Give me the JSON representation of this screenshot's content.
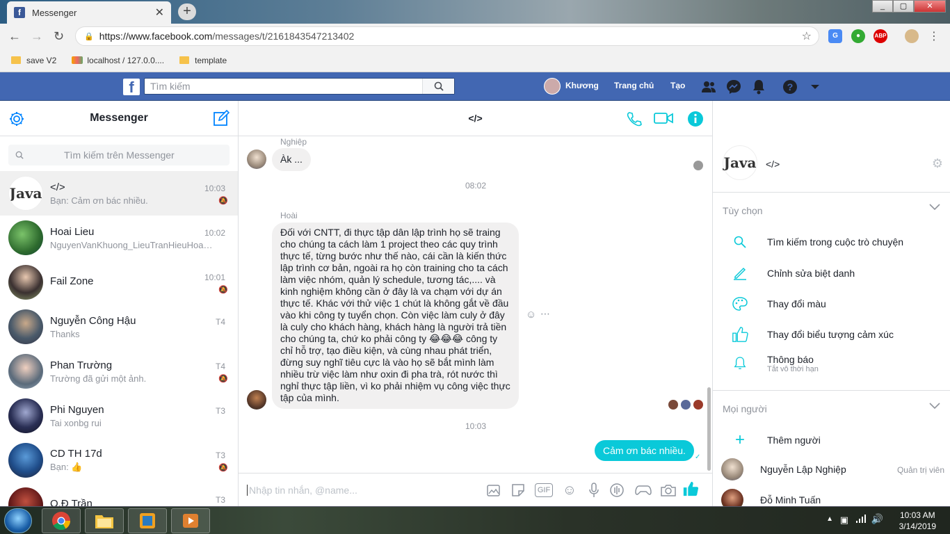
{
  "browser": {
    "tab_title": "Messenger",
    "url_prefix": "https://www.facebook.com",
    "url_path": "/messages/t/2161843547213402",
    "bookmarks": [
      "save V2",
      "localhost / 127.0.0....",
      "template"
    ],
    "ext_abp": "ABP"
  },
  "fb": {
    "logo": "f",
    "search_placeholder": "Tìm kiếm",
    "user": "Khương",
    "home": "Trang chủ",
    "create": "Tạo"
  },
  "left": {
    "title": "Messenger",
    "search_placeholder": "Tìm kiếm trên Messenger",
    "conversations": [
      {
        "name": "</>",
        "snippet": "Bạn: Cảm ơn bác nhiều.",
        "time": "10:03",
        "muted": true
      },
      {
        "name": "Hoai Lieu",
        "snippet": "NguyenVanKhuong_LieuTranHieuHoai_...",
        "time": "10:02",
        "muted": false
      },
      {
        "name": "Fail Zone",
        "snippet": "",
        "time": "10:01",
        "muted": true
      },
      {
        "name": "Nguyễn Công Hậu",
        "snippet": "Thanks",
        "time": "T4",
        "muted": false
      },
      {
        "name": "Phan Trường",
        "snippet": "Trường đã gửi một ảnh.",
        "time": "T4",
        "muted": true
      },
      {
        "name": "Phi Nguyen",
        "snippet": "Tai xonbg rui",
        "time": "T3",
        "muted": false
      },
      {
        "name": "CD TH 17d",
        "snippet": "Bạn:",
        "time": "T3",
        "muted": true
      },
      {
        "name": "Q.Đ Trần",
        "snippet": "",
        "time": "T3",
        "muted": false
      }
    ],
    "java_text": "Java"
  },
  "chat": {
    "title": "</>",
    "messages": [
      {
        "sender": "Nghiệp",
        "text": "Àk ..."
      },
      {
        "time": "08:02"
      },
      {
        "sender": "Hoài",
        "text": "Đối với CNTT, đi thực tập dân lập trình họ sẽ traing cho chúng ta cách làm 1 project theo các quy trình thực tế, từng bước như thế nào, cái cần là kiến thức lập trình cơ bản, ngoài ra họ còn training cho ta cách làm việc nhóm, quản lý schedule, tương tác,.... và kinh nghiệm không cần ở đây là va chạm với dự án thực tế. Khác với thử việc 1 chút là không gắt về đầu vào khi công ty tuyển chọn. Còn việc làm culy ở đây là culy cho khách hàng, khách hàng là người trả tiền cho chúng ta, chứ ko phải công ty 😂😂😂 công ty chỉ hỗ trợ, tạo điều kiện, và cùng nhau phát triển, đừng suy nghĩ tiêu cực là vào họ sẽ bắt mình làm nhiều trừ việc làm như oxin đi pha trà, rót nước thì nghỉ thực tập liền, vì ko phải nhiệm vụ công việc thực tập của mình."
      },
      {
        "time": "10:03"
      },
      {
        "outgoing": true,
        "text": "Cảm ơn bác nhiều."
      }
    ],
    "composer_placeholder": "Nhập tin nhắn, @name...",
    "gif_label": "GIF"
  },
  "right": {
    "name": "</>",
    "java_text": "Java",
    "options_header": "Tùy chọn",
    "options": [
      "Tìm kiếm trong cuộc trò chuyện",
      "Chỉnh sửa biệt danh",
      "Thay đổi màu",
      "Thay đổi biểu tượng cảm xúc"
    ],
    "notify_label": "Thông báo",
    "notify_sub": "Tắt vô thời hạn",
    "people_header": "Mọi người",
    "add_people": "Thêm người",
    "people": [
      {
        "name": "Nguyễn Lập Nghiệp",
        "role": "Quản trị viên"
      },
      {
        "name": "Đỗ Minh Tuấn",
        "role": ""
      }
    ]
  },
  "taskbar": {
    "time": "10:03 AM",
    "date": "3/14/2019"
  },
  "colors": {
    "fb_blue": "#4267b2",
    "accent": "#0ac9d9"
  }
}
